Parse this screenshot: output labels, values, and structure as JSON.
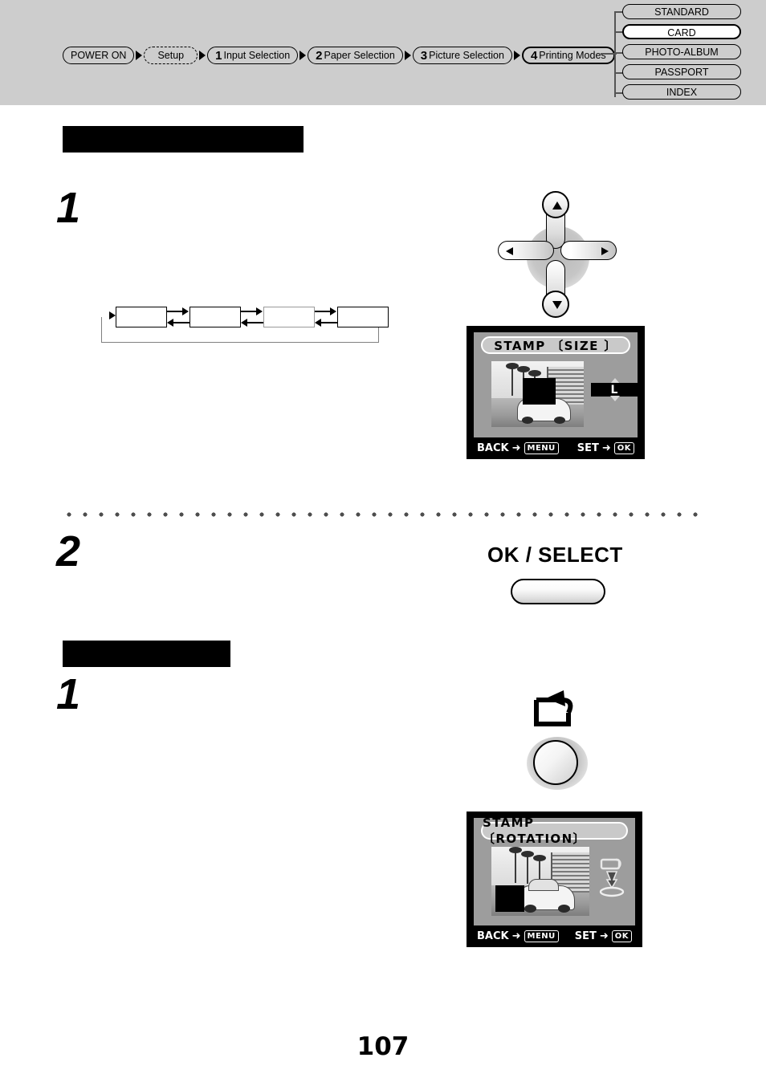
{
  "nav": {
    "breadcrumb": [
      {
        "label": "POWER ON",
        "num": "",
        "style": "solid"
      },
      {
        "label": "Setup",
        "num": "",
        "style": "dashed"
      },
      {
        "label": "Input Selection",
        "num": "1",
        "style": "solid"
      },
      {
        "label": "Paper Selection",
        "num": "2",
        "style": "solid"
      },
      {
        "label": "Picture Selection",
        "num": "3",
        "style": "solid"
      },
      {
        "label": "Printing Modes",
        "num": "4",
        "style": "active"
      }
    ],
    "modes": [
      {
        "label": "STANDARD",
        "selected": false
      },
      {
        "label": "CARD",
        "selected": true
      },
      {
        "label": "PHOTO-ALBUM",
        "selected": false
      },
      {
        "label": "PASSPORT",
        "selected": false
      },
      {
        "label": "INDEX",
        "selected": false
      }
    ],
    "band_color": "#cdcdcd"
  },
  "sections": [
    {
      "heading": "",
      "redacted": true
    },
    {
      "heading": "",
      "redacted": true
    }
  ],
  "steps": {
    "step_1a": "1",
    "step_2": "2",
    "step_1b": "1"
  },
  "flow": {
    "boxes": [
      "",
      "",
      "",
      ""
    ]
  },
  "controls": {
    "dpad": {
      "up": "up-arrow",
      "down": "down-arrow",
      "left": "left-arrow",
      "right": "right-arrow"
    },
    "ok_select_label": "OK / SELECT",
    "rotation_icon": "rotate-icon"
  },
  "lcd_size": {
    "title": "STAMP  〔SIZE 〕",
    "size_value": "L",
    "footer_left_label": "BACK",
    "footer_left_key": "MENU",
    "footer_right_label": "SET",
    "footer_right_key": "OK",
    "arrow_glyph": "➜"
  },
  "lcd_rotation": {
    "title": "STAMP 〔ROTATION〕",
    "footer_left_label": "BACK",
    "footer_left_key": "MENU",
    "footer_right_label": "SET",
    "footer_right_key": "OK",
    "arrow_glyph": "➜"
  },
  "page": {
    "number": "107"
  }
}
